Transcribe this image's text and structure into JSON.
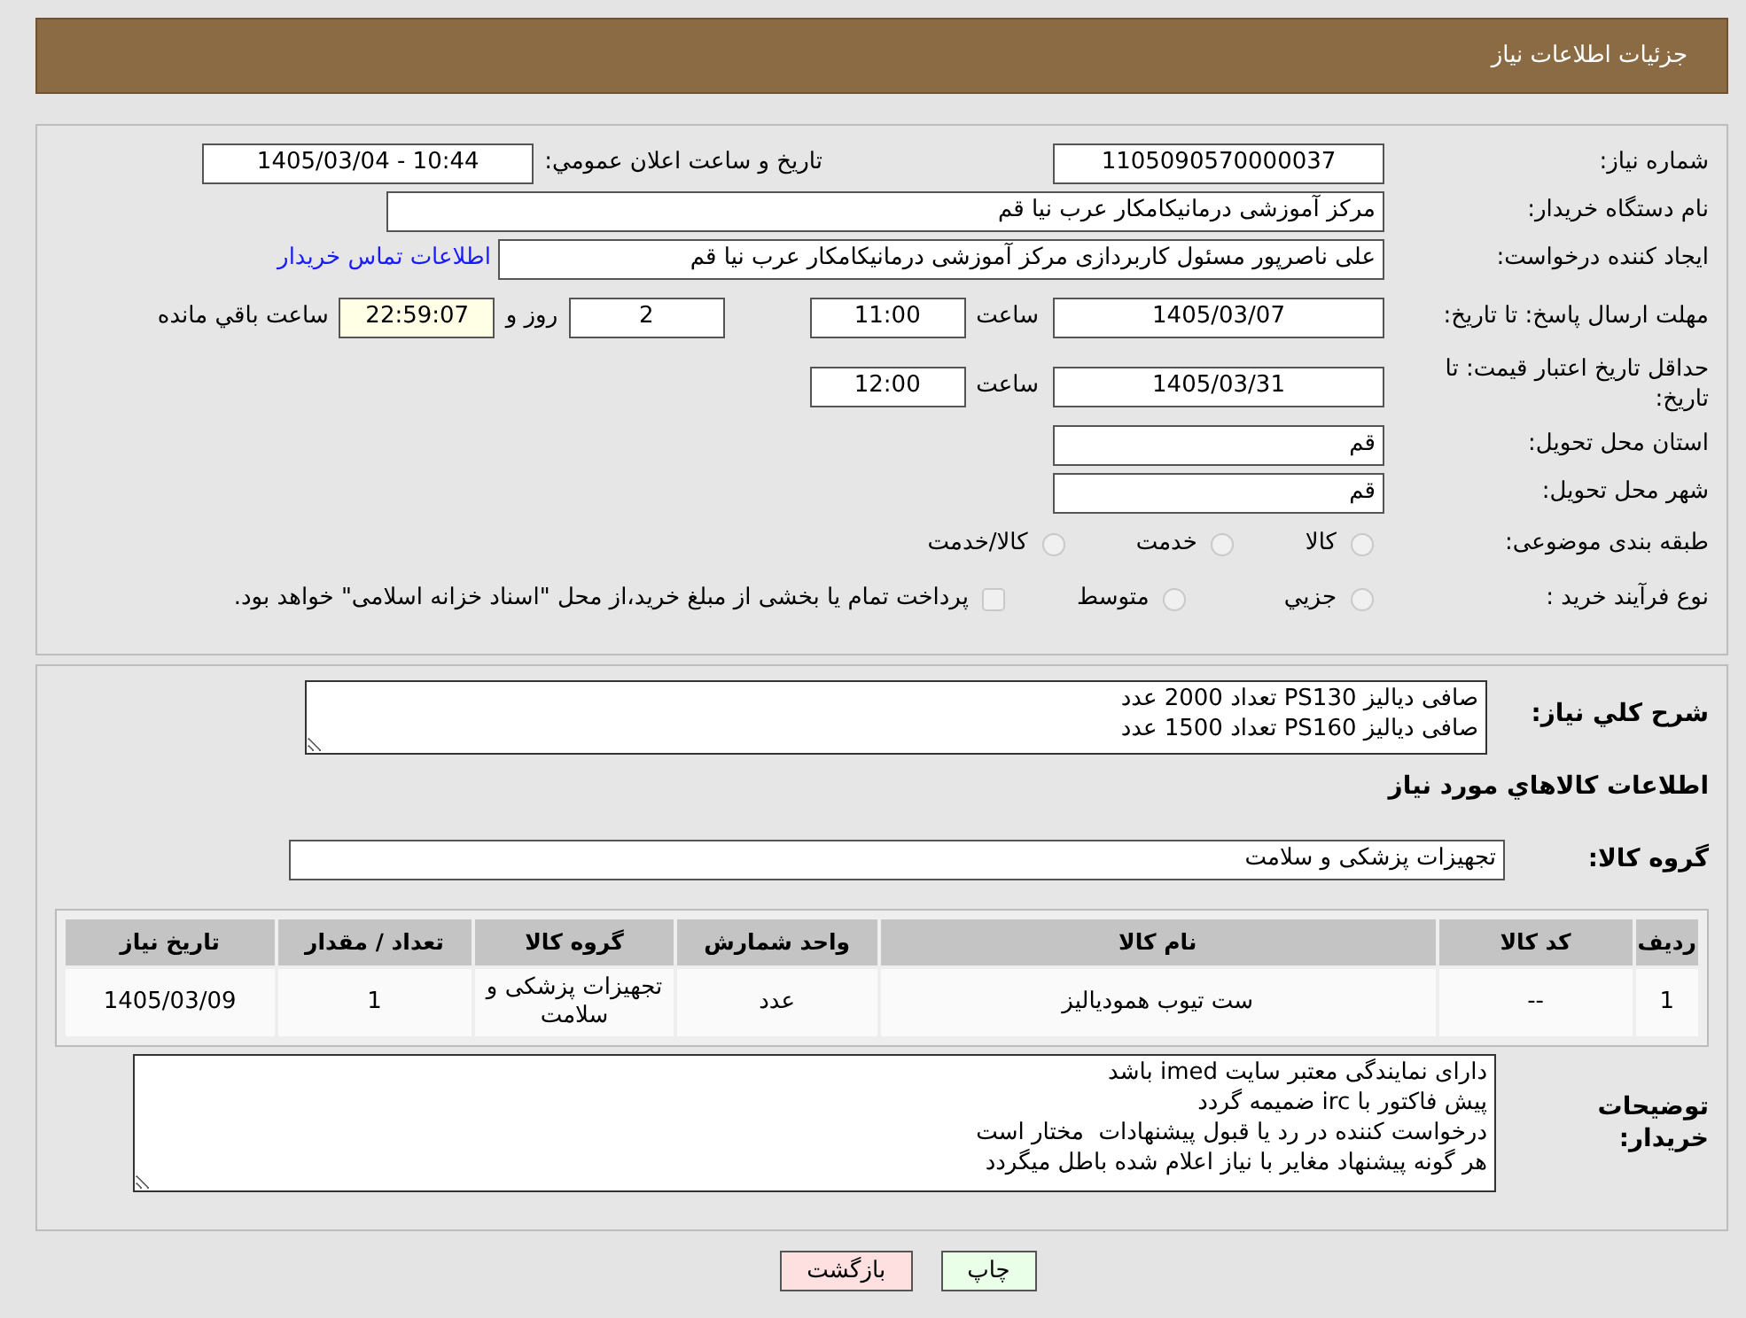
{
  "header": {
    "title": "جزئیات اطلاعات نیاز"
  },
  "need_number": {
    "label": "شماره نیاز:",
    "value": "1105090570000037"
  },
  "announce": {
    "label": "تاریخ و ساعت اعلان عمومي:",
    "value": "1405/03/04 - 10:44"
  },
  "buyer_org": {
    "label": "نام دستگاه خریدار:",
    "value": "مرکز آموزشی درمانیکامکار عرب نیا قم"
  },
  "requester": {
    "label": "ایجاد کننده درخواست:",
    "value": "علی ناصرپور مسئول کاربردازی مرکز آموزشی درمانیکامکار عرب نیا قم",
    "link": "اطلاعات تماس خریدار"
  },
  "reply_deadline": {
    "label": "مهلت ارسال پاسخ: تا تاریخ:",
    "date": "1405/03/07",
    "time_label": "ساعت",
    "time": "11:00",
    "days": "2",
    "days_label": "روز و",
    "remaining": "22:59:07",
    "remaining_label": "ساعت باقي مانده"
  },
  "price_validity": {
    "label": "حداقل تاریخ اعتبار قیمت: تا تاریخ:",
    "date": "1405/03/31",
    "time_label": "ساعت",
    "time": "12:00"
  },
  "province": {
    "label": "استان محل تحویل:",
    "value": "قم"
  },
  "city": {
    "label": "شهر محل تحویل:",
    "value": "قم"
  },
  "category": {
    "label": "طبقه بندی موضوعی:",
    "options": [
      {
        "label": "کالا",
        "selected": false
      },
      {
        "label": "خدمت",
        "selected": false
      },
      {
        "label": "کالا/خدمت",
        "selected": false
      }
    ]
  },
  "process": {
    "label": "نوع فرآیند خرید :",
    "options": [
      {
        "kind": "radio",
        "label": "جزيي",
        "selected": false
      },
      {
        "kind": "radio",
        "label": "متوسط",
        "selected": false
      },
      {
        "kind": "checkbox",
        "label": "پرداخت تمام یا بخشی از مبلغ خرید،از محل \"اسناد خزانه اسلامی\" خواهد بود.",
        "checked": false
      }
    ]
  },
  "description": {
    "label": "شرح کلي نياز:",
    "lines": [
      "صافی دیالیز PS130 تعداد 2000 عدد",
      "صافی دیالیز PS160 تعداد 1500 عدد"
    ]
  },
  "goods_heading": "اطلاعات کالاهاي مورد نياز",
  "goods_group": {
    "label": "گروه کالا:",
    "value": "تجهیزات پزشکی و سلامت"
  },
  "table": {
    "columns": [
      "ردیف",
      "کد کالا",
      "نام کالا",
      "واحد شمارش",
      "گروه کالا",
      "تعداد / مقدار",
      "تاریخ نیاز"
    ],
    "rows": [
      [
        "1",
        "--",
        "ست تیوب همودیالیز",
        "عدد",
        "تجهیزات پزشکی و سلامت",
        "1",
        "1405/03/09"
      ]
    ]
  },
  "buyer_notes": {
    "label": "توضیحات خریدار:",
    "lines": [
      "دارای نمایندگی معتبر سایت imed باشد",
      "پیش فاکتور با irc ضمیمه گردد",
      "درخواست کننده در رد یا قبول پیشنهادات  مختار است",
      "هر گونه پیشنهاد مغایر با نیاز اعلام شده باطل میگردد"
    ]
  },
  "buttons": [
    {
      "kind": "print",
      "label": "چاپ"
    },
    {
      "kind": "back",
      "label": "بازگشت"
    }
  ]
}
